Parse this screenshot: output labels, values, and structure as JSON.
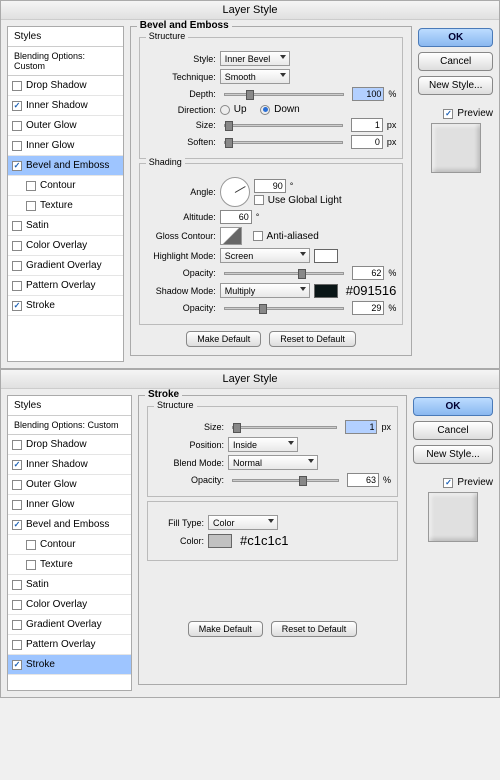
{
  "common": {
    "title": "Layer Style",
    "styles_header": "Styles",
    "blending_options": "Blending Options: Custom",
    "ok": "OK",
    "cancel": "Cancel",
    "new_style": "New Style...",
    "preview_label": "Preview",
    "make_default": "Make Default",
    "reset_default": "Reset to Default"
  },
  "effects": {
    "drop_shadow": "Drop Shadow",
    "inner_shadow": "Inner Shadow",
    "outer_glow": "Outer Glow",
    "inner_glow": "Inner Glow",
    "bevel_emboss": "Bevel and Emboss",
    "contour": "Contour",
    "texture": "Texture",
    "satin": "Satin",
    "color_overlay": "Color Overlay",
    "gradient_overlay": "Gradient Overlay",
    "pattern_overlay": "Pattern Overlay",
    "stroke": "Stroke"
  },
  "panel1": {
    "heading": "Bevel and Emboss",
    "structure": "Structure",
    "style_label": "Style:",
    "style_value": "Inner Bevel",
    "technique_label": "Technique:",
    "technique_value": "Smooth",
    "depth_label": "Depth:",
    "depth_value": "100",
    "depth_unit": "%",
    "direction_label": "Direction:",
    "direction_up": "Up",
    "direction_down": "Down",
    "size_label": "Size:",
    "size_value": "1",
    "size_unit": "px",
    "soften_label": "Soften:",
    "soften_value": "0",
    "soften_unit": "px",
    "shading": "Shading",
    "angle_label": "Angle:",
    "angle_value": "90",
    "angle_unit": "°",
    "global_light": "Use Global Light",
    "altitude_label": "Altitude:",
    "altitude_value": "60",
    "altitude_unit": "°",
    "gloss_contour_label": "Gloss Contour:",
    "anti_aliased": "Anti-aliased",
    "highlight_mode_label": "Highlight Mode:",
    "highlight_mode_value": "Screen",
    "hl_opacity_label": "Opacity:",
    "hl_opacity_value": "62",
    "hl_opacity_unit": "%",
    "shadow_mode_label": "Shadow Mode:",
    "shadow_mode_value": "Multiply",
    "shadow_color": "#091516",
    "shadow_annotation": "#091516",
    "sh_opacity_label": "Opacity:",
    "sh_opacity_value": "29",
    "sh_opacity_unit": "%"
  },
  "panel2": {
    "heading": "Stroke",
    "structure": "Structure",
    "size_label": "Size:",
    "size_value": "1",
    "size_unit": "px",
    "position_label": "Position:",
    "position_value": "Inside",
    "blend_mode_label": "Blend Mode:",
    "blend_mode_value": "Normal",
    "opacity_label": "Opacity:",
    "opacity_value": "63",
    "opacity_unit": "%",
    "fill_type_label": "Fill Type:",
    "fill_type_value": "Color",
    "color_label": "Color:",
    "color_value": "#c1c1c1",
    "color_annotation": "#c1c1c1"
  }
}
